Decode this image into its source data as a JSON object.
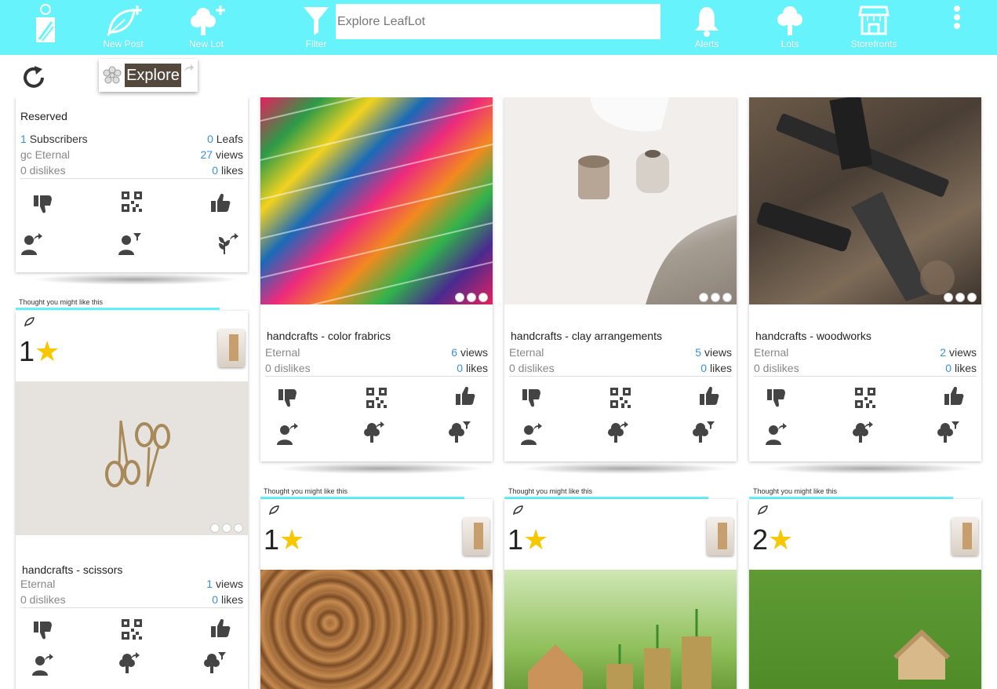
{
  "topbar": {
    "new_post": "New Post",
    "new_lot": "New Lot",
    "filter": "Filter",
    "search_placeholder": "Explore LeafLot",
    "alerts": "Alerts",
    "lots": "Lots",
    "storefronts": "Storefronts"
  },
  "subbar": {
    "explore": "Explore"
  },
  "profile_card": {
    "status": "Reserved",
    "subscribers_count": "1",
    "subscribers_label": "Subscribers",
    "leafs_count": "0",
    "leafs_label": "Leafs",
    "gc": "gc Eternal",
    "views_count": "27",
    "views_label": "views",
    "dislikes": "0 dislikes",
    "likes_count": "0",
    "likes_label": "likes"
  },
  "thought_label": "Thought you might like this",
  "cards": [
    {
      "title": "handcrafts - color frabrics",
      "term": "Eternal",
      "views": "6",
      "views_label": "views",
      "dislikes": "0 dislikes",
      "likes": "0",
      "likes_label": "likes"
    },
    {
      "title": "handcrafts - clay arrangements",
      "term": "Eternal",
      "views": "5",
      "views_label": "views",
      "dislikes": "0 dislikes",
      "likes": "0",
      "likes_label": "likes"
    },
    {
      "title": "handcrafts - woodworks",
      "term": "Eternal",
      "views": "2",
      "views_label": "views",
      "dislikes": "0 dislikes",
      "likes": "0",
      "likes_label": "likes"
    },
    {
      "title": "handcrafts - scissors",
      "term": "Eternal",
      "views": "1",
      "views_label": "views",
      "dislikes": "0 dislikes",
      "likes": "0",
      "likes_label": "likes",
      "rating": "1"
    }
  ],
  "bottom_ratings": [
    "1",
    "1",
    "2"
  ],
  "star": "★",
  "colors": {
    "topbar": "#66f3fb",
    "link": "#3a8fdc",
    "star": "#f7c800",
    "explore_bg": "#54483d"
  }
}
